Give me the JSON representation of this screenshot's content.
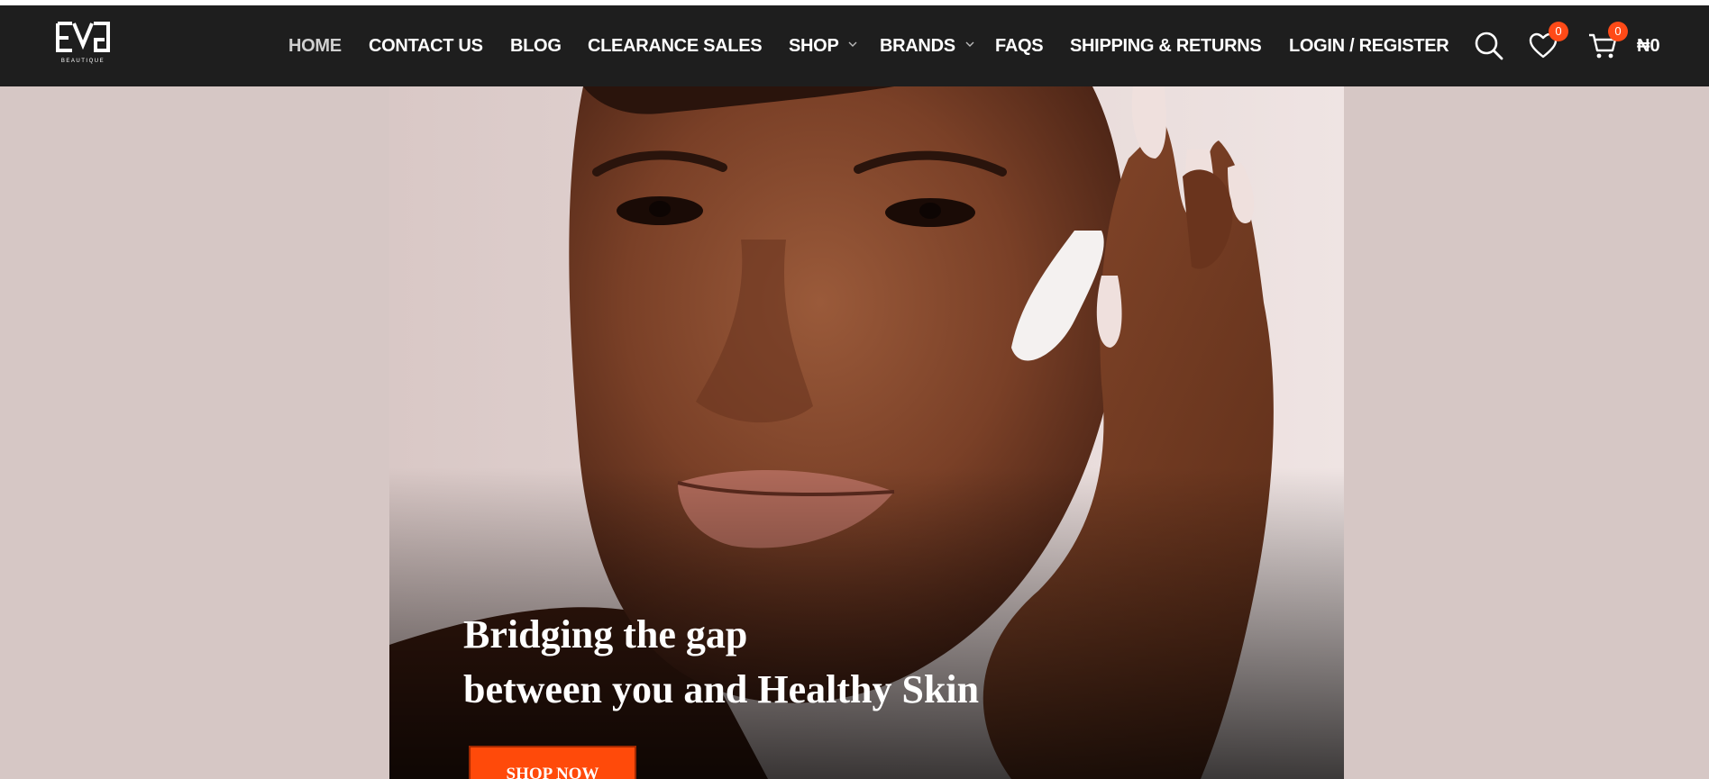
{
  "brand": {
    "logo_text": "EVG",
    "logo_subtext": "BEAUTIQUE"
  },
  "nav": {
    "items": [
      {
        "label": "HOME",
        "active": true
      },
      {
        "label": "CONTACT US"
      },
      {
        "label": "BLOG"
      },
      {
        "label": "CLEARANCE SALES"
      },
      {
        "label": "SHOP",
        "has_dropdown": true
      },
      {
        "label": "BRANDS",
        "has_dropdown": true
      },
      {
        "label": "FAQS"
      },
      {
        "label": "SHIPPING & RETURNS"
      },
      {
        "label": "LOGIN / REGISTER"
      }
    ]
  },
  "header_actions": {
    "search_icon": "search-icon",
    "wishlist_icon": "heart-icon",
    "wishlist_count": "0",
    "cart_icon": "cart-icon",
    "cart_count": "0",
    "cart_total": "₦0"
  },
  "hero": {
    "title_line1": "Bridging the gap",
    "title_line2": "between you and Healthy Skin",
    "cta_label": "SHOP NOW"
  },
  "colors": {
    "header_bg": "#1e1e1e",
    "page_bg": "#d6c7c5",
    "accent": "#ff4a0a",
    "badge": "#ff4a17"
  }
}
